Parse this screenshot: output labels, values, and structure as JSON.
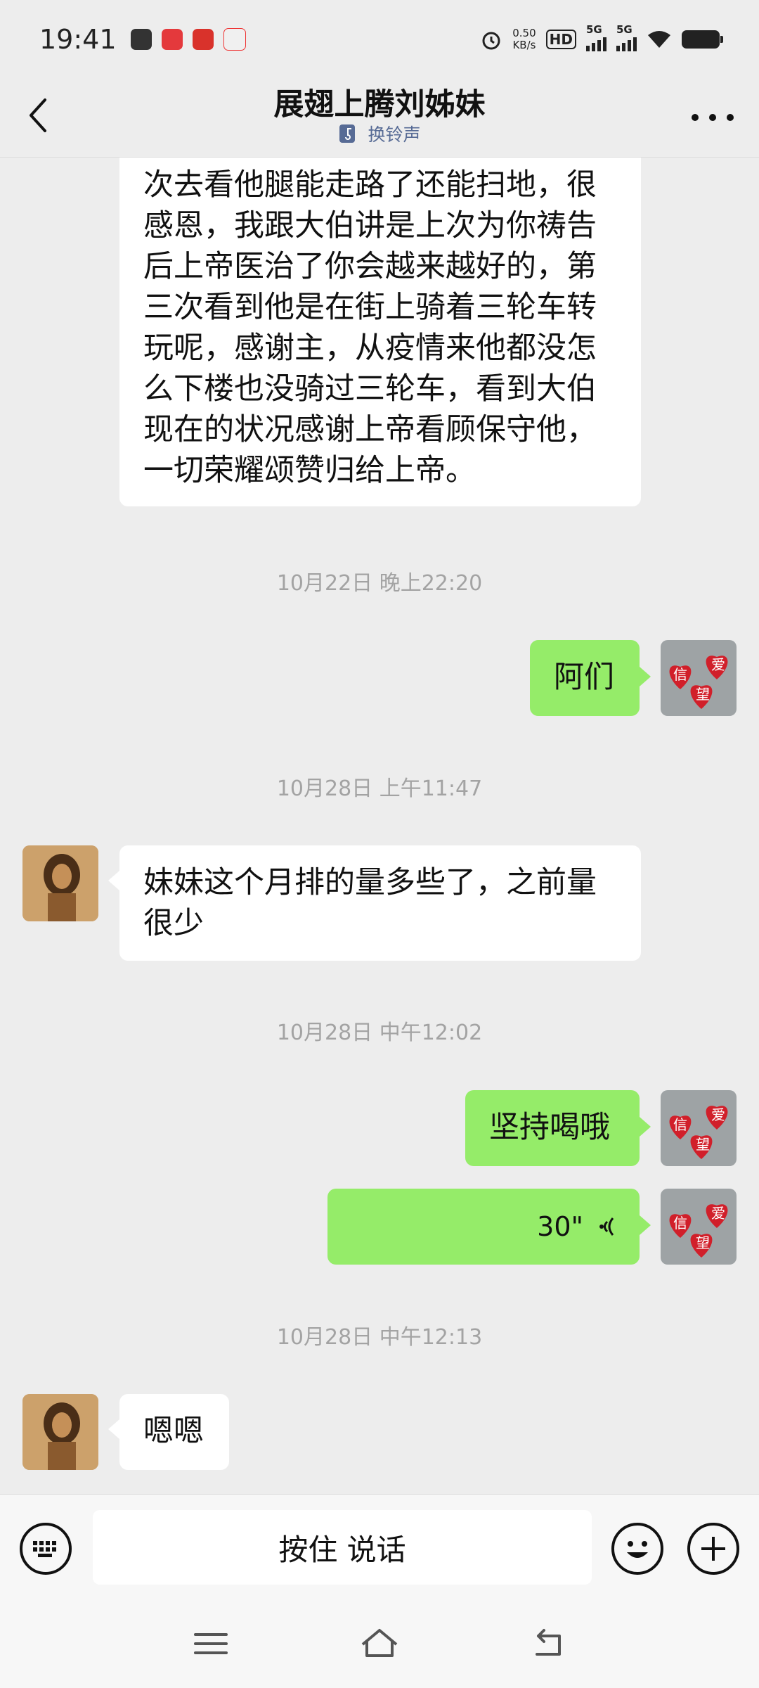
{
  "status_bar": {
    "time": "19:41",
    "net_speed_value": "0.50",
    "net_speed_unit": "KB/s",
    "hd_label": "HD",
    "sim1_label": "5G",
    "sim2_label": "5G"
  },
  "header": {
    "title": "展翅上腾刘姊妹",
    "subtitle": "换铃声"
  },
  "messages": [
    {
      "side": "received",
      "text": "次去看他腿能走路了还能扫地，很感恩，我跟大伯讲是上次为你祷告后上帝医治了你会越来越好的，第三次看到他是在街上骑着三轮车转玩呢，感谢主，从疫情来他都没怎么下楼也没骑过三轮车，看到大伯现在的状况感谢上帝看顾保守他，一切荣耀颂赞归给上帝。"
    },
    {
      "timestamp": "10月22日 晚上22:20"
    },
    {
      "side": "sent",
      "text": "阿们"
    },
    {
      "timestamp": "10月28日 上午11:47"
    },
    {
      "side": "received",
      "text": "妹妹这个月排的量多些了，之前量很少"
    },
    {
      "timestamp": "10月28日 中午12:02"
    },
    {
      "side": "sent",
      "text": "坚持喝哦"
    },
    {
      "side": "sent",
      "voice": "30\""
    },
    {
      "timestamp": "10月28日 中午12:13"
    },
    {
      "side": "received",
      "text": "嗯嗯"
    }
  ],
  "input_bar": {
    "hold_to_talk": "按住 说话"
  },
  "avatar_self": {
    "hearts": [
      "信",
      "爱",
      "望"
    ]
  },
  "colors": {
    "sent_bubble": "#95ec69",
    "received_bubble": "#ffffff",
    "background": "#ededed",
    "link": "#576b95"
  }
}
